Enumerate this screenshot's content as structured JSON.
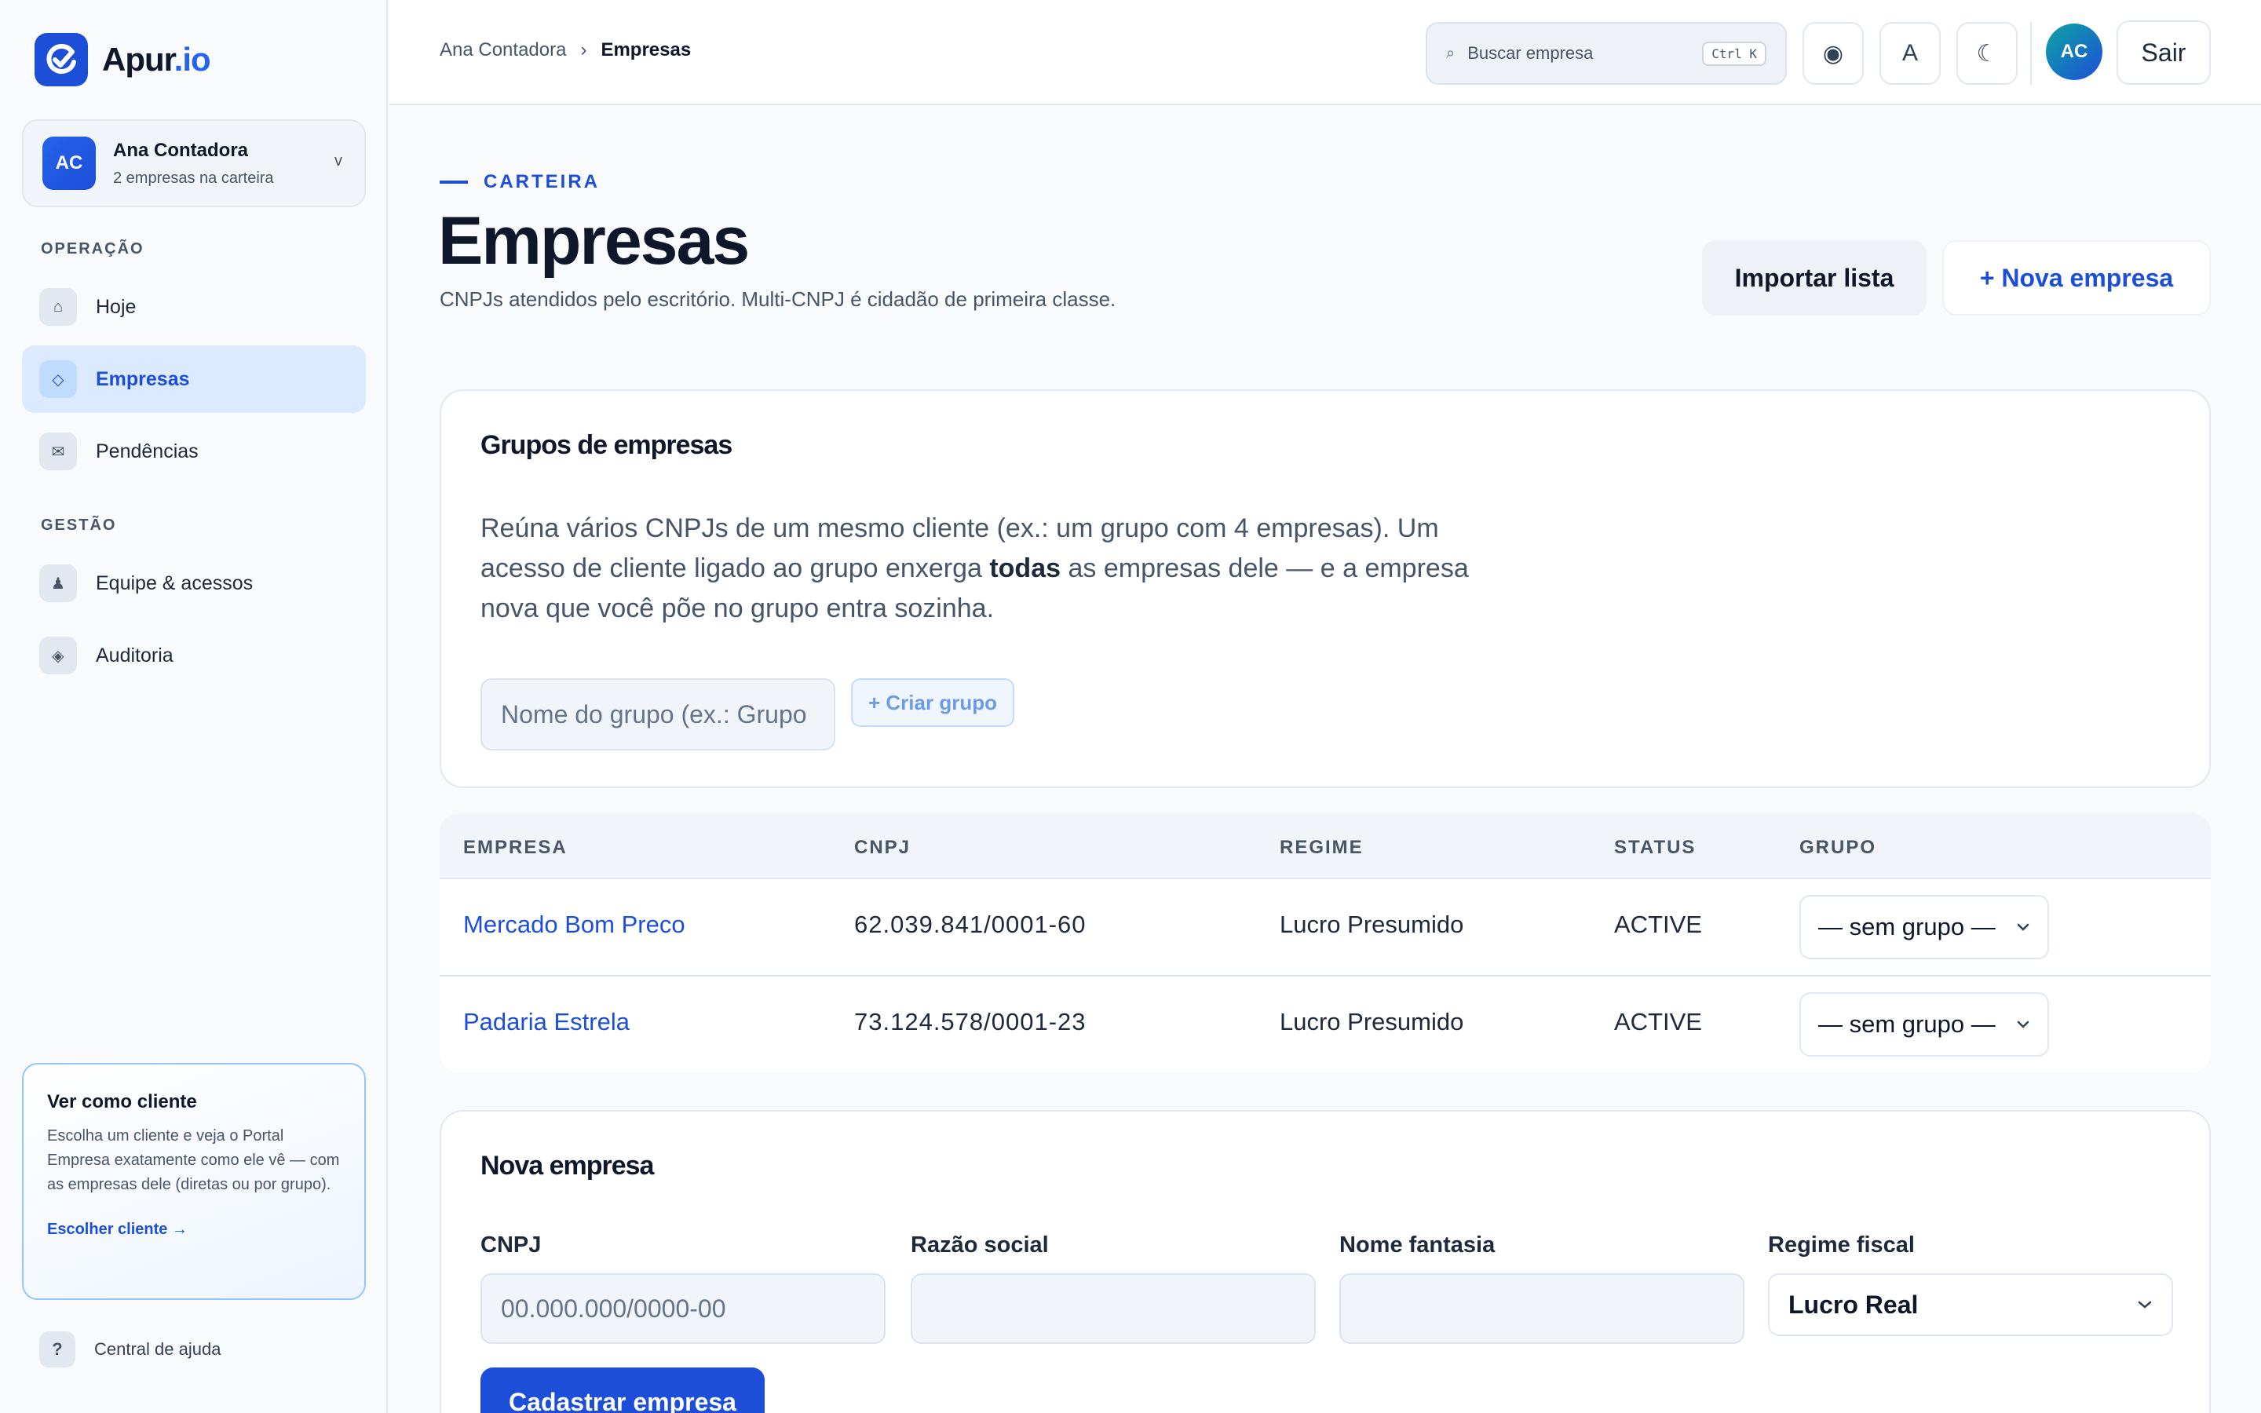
{
  "app": {
    "logo_main": "Apur",
    "logo_accent": ".io"
  },
  "account": {
    "initials": "AC",
    "name": "Ana Contadora",
    "subtitle": "2 empresas na carteira",
    "chevron": "v"
  },
  "sidebar": {
    "sections": [
      {
        "label": "OPERAÇÃO"
      },
      {
        "label": "GESTÃO"
      }
    ],
    "items": [
      {
        "label": "Hoje",
        "icon": "⌂",
        "active": false
      },
      {
        "label": "Empresas",
        "icon": "◇",
        "active": true
      },
      {
        "label": "Pendências",
        "icon": "✉",
        "active": false
      },
      {
        "label": "Equipe & acessos",
        "icon": "♟",
        "active": false
      },
      {
        "label": "Auditoria",
        "icon": "◈",
        "active": false
      }
    ],
    "client_card": {
      "title": "Ver como cliente",
      "description": "Escolha um cliente e veja o Portal Empresa exatamente como ele vê — com as empresas dele (diretas ou por grupo).",
      "link": "Escolher cliente →"
    },
    "help": {
      "icon": "?",
      "label": "Central de ajuda"
    }
  },
  "topbar": {
    "breadcrumb": {
      "parent": "Ana Contadora",
      "separator": "›",
      "current": "Empresas"
    },
    "search": {
      "icon": "⌕",
      "placeholder": "Buscar empresa",
      "shortcut": "Ctrl K"
    },
    "buttons": {
      "record_icon": "◉",
      "font_icon": "A",
      "theme_icon": "☾"
    },
    "user_initials": "AC",
    "logout_label": "Sair"
  },
  "page": {
    "eyebrow": "CARTEIRA",
    "title": "Empresas",
    "subtitle": "CNPJs atendidos pelo escritório. Multi-CNPJ é cidadão de primeira classe.",
    "import_label": "Importar lista",
    "new_label": "+ Nova empresa"
  },
  "groups": {
    "title": "Grupos de empresas",
    "description_before": "Reúna vários CNPJs de um mesmo cliente (ex.: um grupo com 4 empresas). Um acesso de cliente ligado ao grupo enxerga ",
    "description_bold": "todas",
    "description_after": " as empresas dele — e a empresa nova que você põe no grupo entra sozinha.",
    "input_placeholder": "Nome do grupo (ex.: Grupo",
    "create_label": "+ Criar grupo"
  },
  "table": {
    "columns": [
      "EMPRESA",
      "CNPJ",
      "REGIME",
      "STATUS",
      "GRUPO"
    ],
    "rows": [
      {
        "empresa": "Mercado Bom Preco",
        "cnpj": "62.039.841/0001-60",
        "regime": "Lucro Presumido",
        "status": "ACTIVE",
        "grupo": "— sem grupo —"
      },
      {
        "empresa": "Padaria Estrela",
        "cnpj": "73.124.578/0001-23",
        "regime": "Lucro Presumido",
        "status": "ACTIVE",
        "grupo": "— sem grupo —"
      }
    ]
  },
  "new_company": {
    "title": "Nova empresa",
    "fields": {
      "cnpj_label": "CNPJ",
      "cnpj_placeholder": "00.000.000/0000-00",
      "razao_label": "Razão social",
      "fantasia_label": "Nome fantasia",
      "regime_label": "Regime fiscal",
      "regime_value": "Lucro Real"
    },
    "submit_label": "Cadastrar empresa"
  },
  "colors": {
    "accent": "#1d4ed8",
    "active_bg": "#dbeafe",
    "text": "#0f172a",
    "muted": "#475569"
  }
}
